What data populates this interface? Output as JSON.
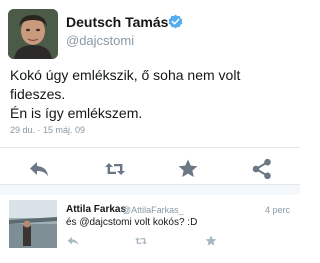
{
  "tweet": {
    "author_name": "Deutsch Tamás",
    "handle": "@dajcstomi",
    "verified": true,
    "text_lines": [
      "Kokó úgy emlékszik, ő soha nem volt",
      "fideszes.",
      "Én is így emlékszem."
    ],
    "timestamp": "29 du. · 15 máj. 09",
    "actions": [
      "reply-icon",
      "retweet-icon",
      "favorite-icon",
      "share-icon"
    ]
  },
  "reply": {
    "author_name": "Attila Farkas",
    "handle": "@AttilaFarkas_",
    "time": "4 perc",
    "text": "és @dajcstomi volt kokós? :D",
    "actions": [
      "reply-icon",
      "retweet-icon",
      "favorite-icon"
    ]
  },
  "colors": {
    "text": "#14171a",
    "muted": "#8899a6",
    "action_icon": "#6b7784",
    "verified_blue": "#55acee",
    "divider": "#e1e8ed"
  }
}
